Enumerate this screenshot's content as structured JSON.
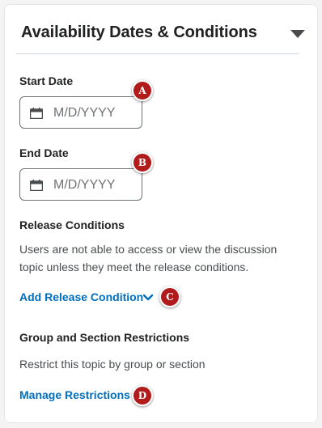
{
  "header": {
    "title": "Availability Dates & Conditions",
    "toggle_icon": "caret-down-icon"
  },
  "start_date": {
    "label": "Start Date",
    "placeholder": "M/D/YYYY",
    "icon": "calendar-icon",
    "badge": "A"
  },
  "end_date": {
    "label": "End Date",
    "placeholder": "M/D/YYYY",
    "icon": "calendar-icon",
    "badge": "B"
  },
  "release_conditions": {
    "heading": "Release Conditions",
    "description_line1": "Users are not able to access or view the discussion",
    "description_line2": "topic unless they meet the release conditions.",
    "add_link": "Add Release Condition",
    "add_icon": "chevron-down-icon",
    "badge": "C"
  },
  "restrictions": {
    "heading": "Group and Section Restrictions",
    "description": "Restrict this topic by group or section",
    "manage_link": "Manage Restrictions",
    "badge": "D"
  },
  "colors": {
    "link": "#006fbf",
    "badge": "#b21b1b",
    "text": "#202122",
    "muted": "#494c4e"
  }
}
